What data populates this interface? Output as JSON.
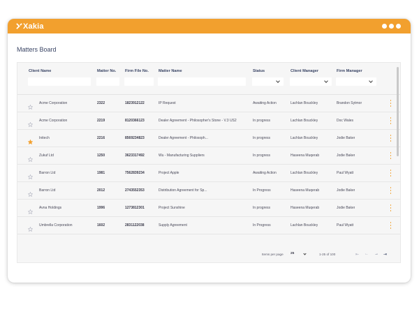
{
  "app": {
    "logo_text": "Xakia",
    "accent_color": "#f2a02e"
  },
  "page": {
    "title": "Matters Board"
  },
  "columns": {
    "client_name": "Client Name",
    "matter_no": "Matter No.",
    "firm_file_no": "Firm File No.",
    "matter_name": "Matter Name",
    "status": "Status",
    "client_manager": "Client Manager",
    "firm_manager": "Firm Manager"
  },
  "rows": [
    {
      "client": "Acme Corporation",
      "matter_no": "2322",
      "firm_file": "1823912122",
      "matter": "IP Request",
      "status": "Awaiting Action",
      "client_manager": "Lachlan Bouckley",
      "firm_manager": "Brandon Sytmor",
      "starred": false
    },
    {
      "client": "Acme Corporation",
      "matter_no": "2219",
      "firm_file": "8120366123",
      "matter": "Dealer Agreement - Philosopher's Stone - V.3 US2",
      "status": "In progress",
      "client_manager": "Lachlan Bouckley",
      "firm_manager": "Doc Wales",
      "starred": false
    },
    {
      "client": "Initech",
      "matter_no": "2216",
      "firm_file": "8569234823",
      "matter": "Dealer Agreement - Philosoph...",
      "status": "In progress",
      "client_manager": "Lachlan Bouckley",
      "firm_manager": "Jodie Baker",
      "starred": true
    },
    {
      "client": "Zukuf Ltd",
      "matter_no": "1250",
      "firm_file": "3623317492",
      "matter": "Wu - Manufacturing Suppliers",
      "status": "In progress",
      "client_manager": "Haseena Muqerab",
      "firm_manager": "Jodie Baker",
      "starred": false
    },
    {
      "client": "Barron Ltd",
      "matter_no": "1981",
      "firm_file": "7562839234",
      "matter": "Project Apple",
      "status": "Awaiting Action",
      "client_manager": "Lachlan Bouckley",
      "firm_manager": "Paul Wyatt",
      "starred": false
    },
    {
      "client": "Barron Ltd",
      "matter_no": "2012",
      "firm_file": "2743552353",
      "matter": "Distribution Agreement for Sp...",
      "status": "In Progress",
      "client_manager": "Haseena Muqerab",
      "firm_manager": "Jodie Baker",
      "starred": false
    },
    {
      "client": "Avna Holdings",
      "matter_no": "1996",
      "firm_file": "1273812301",
      "matter": "Project Sunshine",
      "status": "In progress",
      "client_manager": "Haseena Muqerab",
      "firm_manager": "Jodie Baker",
      "starred": false
    },
    {
      "client": "Umbrella Corporation",
      "matter_no": "1602",
      "firm_file": "2831122038",
      "matter": "Supply Agreement",
      "status": "In Progress",
      "client_manager": "Lachlan Bouckley",
      "firm_manager": "Paul Wyatt",
      "starred": false
    }
  ],
  "footer": {
    "items_per_page_label": "Items per page",
    "items_per_page_value": "25",
    "range": "1-25 of 100"
  },
  "icons": {
    "logo": "x-logo-icon",
    "window_menu": "three-dots-icon",
    "favorite": "star-icon",
    "row_menu": "kebab-icon",
    "pager": [
      "first-page-icon",
      "prev-page-icon",
      "next-page-icon",
      "last-page-icon"
    ]
  }
}
